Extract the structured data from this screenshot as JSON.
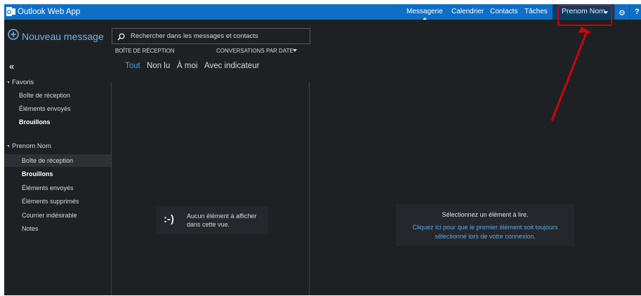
{
  "header": {
    "app_title": "Outlook Web App",
    "nav": [
      "Messagerie",
      "Calendrier",
      "Contacts",
      "Tâches"
    ],
    "user_name": "Prenom Nom",
    "gear_icon": "gear-icon",
    "help_label": "?"
  },
  "compose": {
    "label": "Nouveau message",
    "icon": "plus-circle-icon"
  },
  "search": {
    "placeholder": "Rechercher dans les messages et contacts"
  },
  "list": {
    "folder_label": "BOÎTE DE RÉCEPTION",
    "sort_label": "CONVERSATIONS PAR DATE",
    "filters": [
      "Tout",
      "Non lu",
      "À moi",
      "Avec indicateur"
    ],
    "empty_line1": "Aucun élément à afficher",
    "empty_line2": "dans cette vue.",
    "empty_icon": ":-)"
  },
  "sidebar": {
    "collapse_label": "«",
    "favorites": {
      "title": "Favoris",
      "items": [
        "Boîte de réception",
        "Éléments envoyés",
        "Brouillons"
      ]
    },
    "account": {
      "title": "Prenom Nom",
      "items": [
        "Boîte de réception",
        "Brouillons",
        "Éléments envoyés",
        "Éléments supprimés",
        "Courrier indésirable",
        "Notes"
      ]
    }
  },
  "reading": {
    "line1": "Sélectionnez un élément à lire.",
    "link_line1": "Cliquez ici pour que le premier élément soit toujours",
    "link_line2": "sélectionné lors de votre connexion."
  },
  "colors": {
    "brand": "#0f6fc6",
    "background": "#1e2124",
    "accent": "#4a9de0",
    "annotation": "#d00000"
  }
}
